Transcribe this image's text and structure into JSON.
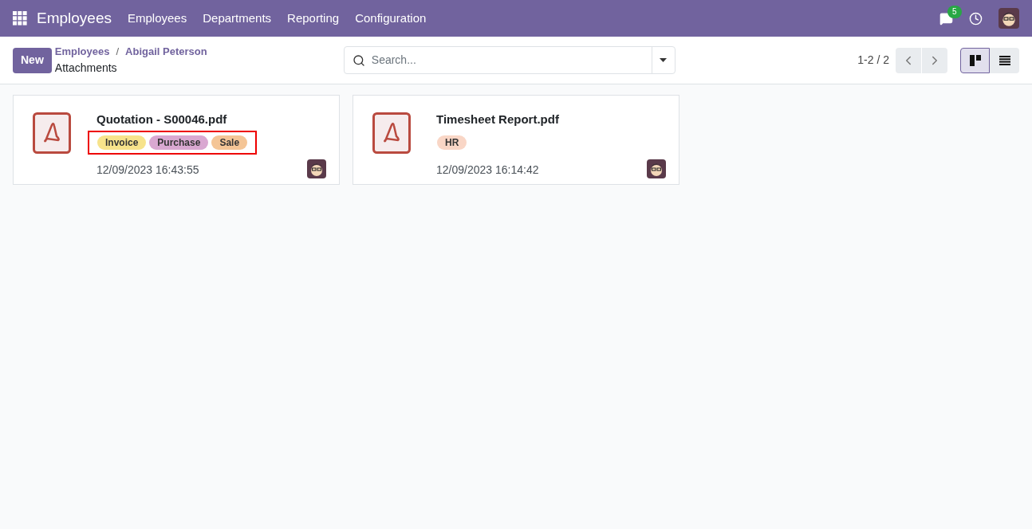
{
  "navbar": {
    "app_name": "Employees",
    "menu": [
      "Employees",
      "Departments",
      "Reporting",
      "Configuration"
    ],
    "messages_count": "5"
  },
  "control_panel": {
    "new_button": "New",
    "breadcrumbs": [
      "Employees",
      "Abigail Peterson"
    ],
    "breadcrumb_separator": "/",
    "title": "Attachments",
    "search": {
      "placeholder": "Search..."
    },
    "pager": "1-2 / 2",
    "views": [
      {
        "kind": "kanban",
        "selected": true
      },
      {
        "kind": "list",
        "selected": false
      }
    ]
  },
  "cards": [
    {
      "name": "Quotation - S00046.pdf",
      "tags_highlighted": true,
      "tags": [
        {
          "label": "Invoice",
          "color": "#f7e38b"
        },
        {
          "label": "Purchase",
          "color": "#d9a8d1"
        },
        {
          "label": "Sale",
          "color": "#f4c596"
        }
      ],
      "date": "12/09/2023 16:43:55"
    },
    {
      "name": "Timesheet Report.pdf",
      "tags_highlighted": false,
      "tags": [
        {
          "label": "HR",
          "color": "#f9d6c6"
        }
      ],
      "date": "12/09/2023 16:14:42"
    }
  ]
}
